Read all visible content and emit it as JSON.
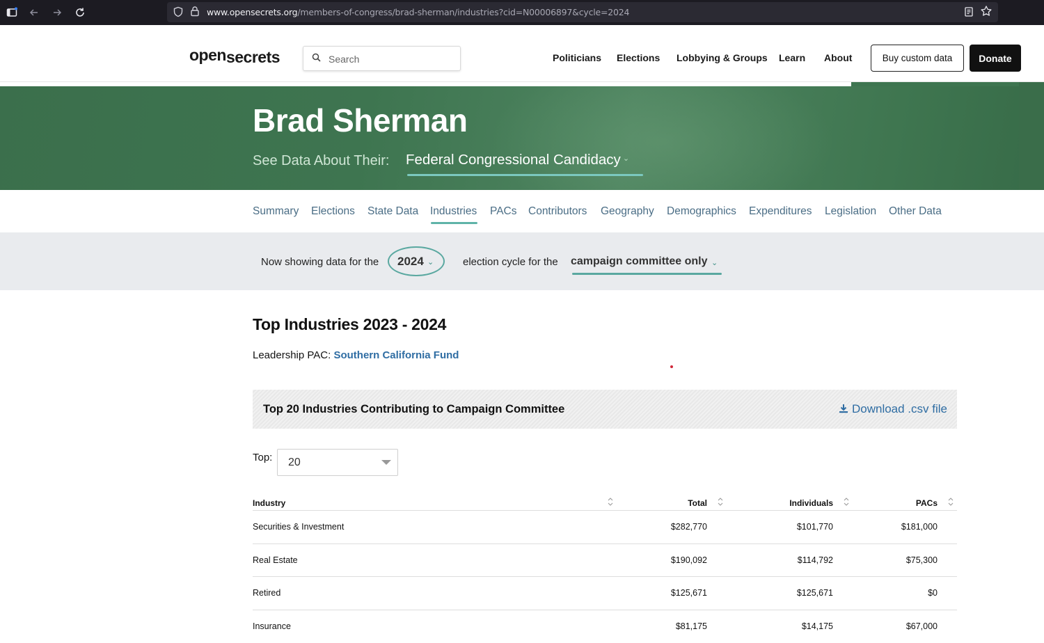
{
  "browser": {
    "url_host": "www.opensecrets.org",
    "url_path": "/members-of-congress/brad-sherman/industries?cid=N00006897&cycle=2024"
  },
  "header": {
    "logo_open": "open",
    "logo_secrets": "secrets",
    "search_placeholder": "Search",
    "nav": [
      "Politicians",
      "Elections",
      "Lobbying & Groups",
      "Learn",
      "About"
    ],
    "buy_custom_data": "Buy custom data",
    "donate": "Donate"
  },
  "hero": {
    "name": "Brad Sherman",
    "see_data_label": "See Data About Their:",
    "selected_view": "Federal Congressional Candidacy"
  },
  "subnav": {
    "items": [
      "Summary",
      "Elections",
      "State Data",
      "Industries",
      "PACs",
      "Contributors",
      "Geography",
      "Demographics",
      "Expenditures",
      "Legislation",
      "Other Data"
    ],
    "active": "Industries"
  },
  "cycle": {
    "prefix": "Now showing data for the",
    "year": "2024",
    "middle": "election cycle for the",
    "scope": "campaign committee only"
  },
  "main": {
    "title": "Top Industries 2023 - 2024",
    "leadership_label": "Leadership PAC:",
    "leadership_pac": "Southern California Fund",
    "panel_title": "Top 20 Industries Contributing to Campaign Committee",
    "download_label": "Download .csv file",
    "top_label": "Top:",
    "top_value": "20"
  },
  "table": {
    "headers": {
      "industry": "Industry",
      "total": "Total",
      "individuals": "Individuals",
      "pacs": "PACs"
    },
    "rows": [
      {
        "industry": "Securities & Investment",
        "total": "$282,770",
        "individuals": "$101,770",
        "pacs": "$181,000"
      },
      {
        "industry": "Real Estate",
        "total": "$190,092",
        "individuals": "$114,792",
        "pacs": "$75,300"
      },
      {
        "industry": "Retired",
        "total": "$125,671",
        "individuals": "$125,671",
        "pacs": "$0"
      },
      {
        "industry": "Insurance",
        "total": "$81,175",
        "individuals": "$14,175",
        "pacs": "$67,000"
      }
    ]
  }
}
